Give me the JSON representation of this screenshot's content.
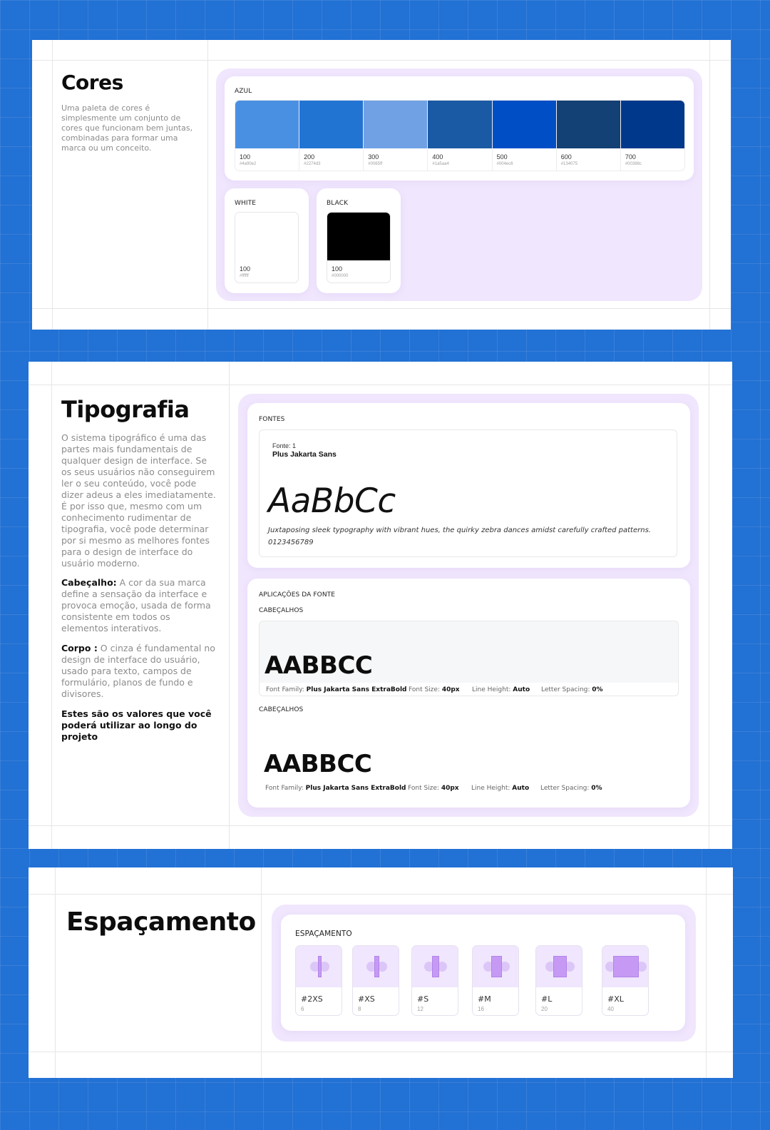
{
  "colors": {
    "title": "Cores",
    "description": "Uma paleta de cores é simplesmente um conjunto de cores que funcionam bem juntas, combinadas para formar uma marca ou um conceito.",
    "azul": {
      "label": "AZUL",
      "swatches": [
        {
          "name": "100",
          "hex": "#4a90e2",
          "color": "#4a90e2"
        },
        {
          "name": "200",
          "hex": "#2274d3",
          "color": "#2274d3"
        },
        {
          "name": "300",
          "hex": "#0065ff",
          "color": "#6fa1e4"
        },
        {
          "name": "400",
          "hex": "#1a5aa4",
          "color": "#1a5aa4"
        },
        {
          "name": "500",
          "hex": "#004ec6",
          "color": "#004ec6"
        },
        {
          "name": "600",
          "hex": "#134075",
          "color": "#134075"
        },
        {
          "name": "700",
          "hex": "#00388c",
          "color": "#00388c"
        }
      ]
    },
    "white": {
      "label": "WHITE",
      "name": "100",
      "hex": "#ffffff",
      "color": "#ffffff"
    },
    "black": {
      "label": "BLACK",
      "name": "100",
      "hex": "#000000",
      "color": "#000000"
    }
  },
  "typography": {
    "title": "Tipografia",
    "intro": "O sistema tipográfico é uma das partes mais fundamentais de qualquer design de interface. Se os seus usuários não conseguirem ler o seu conteúdo, você pode dizer adeus a eles imediatamente. É por isso que, mesmo com um conhecimento rudimentar de tipografia, você pode determinar por si mesmo as melhores fontes para o design de interface do usuário moderno.",
    "header_label": "Cabeçalho:",
    "header_text": "A cor da sua marca define a sensação da interface e provoca emoção, usada de forma consistente em todos os elementos interativos.",
    "body_label": "Corpo :",
    "body_text": "O cinza é fundamental no design de interface do usuário, usado para texto, campos de formulário, planos de fundo e divisores.",
    "closing": "Estes são os valores que você poderá utilizar ao longo do projeto",
    "fonts_label": "FONTES",
    "font_index": "Fonte: 1",
    "font_name": "Plus Jakarta Sans",
    "sample": "AaBbCc",
    "pangram": "Juxtaposing sleek typography with vibrant hues, the quirky zebra dances amidst carefully crafted patterns.",
    "digits": "0123456789",
    "applications_label": "APLICAÇÕES DA FONTE",
    "headings": [
      {
        "label": "CABEÇALHOS",
        "sample": "AABBCC",
        "family_label": "Font Family:",
        "family": "Plus Jakarta Sans ExtraBold",
        "size_label": "Font Size:",
        "size": "40px",
        "line_label": "Line Height:",
        "line": "Auto",
        "spacing_label": "Letter Spacing:",
        "spacing": "0%"
      },
      {
        "label": "CABEÇALHOS",
        "sample": "AABBCC",
        "family_label": "Font Family:",
        "family": "Plus Jakarta Sans ExtraBold",
        "size_label": "Font Size:",
        "size": "40px",
        "line_label": "Line Height:",
        "line": "Auto",
        "spacing_label": "Letter Spacing:",
        "spacing": "0%"
      }
    ]
  },
  "spacing": {
    "title": "Espaçamento",
    "label": "ESPAÇAMENTO",
    "items": [
      {
        "name": "#2XS",
        "value": "6"
      },
      {
        "name": "#XS",
        "value": "8"
      },
      {
        "name": "#S",
        "value": "12"
      },
      {
        "name": "#M",
        "value": "16"
      },
      {
        "name": "#L",
        "value": "20"
      },
      {
        "name": "#XL",
        "value": "40"
      }
    ]
  }
}
